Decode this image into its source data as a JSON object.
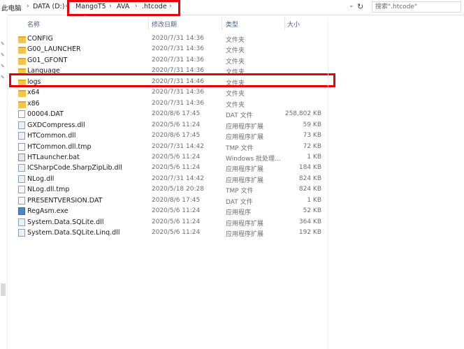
{
  "address": {
    "items": [
      "此电脑",
      "DATA (D:)",
      "MangoT5",
      "AVA",
      ".htcode"
    ],
    "search_placeholder": "搜索\".htcode\""
  },
  "columns": {
    "name": "名称",
    "date": "修改日期",
    "type": "类型",
    "size": "大小"
  },
  "files": [
    {
      "name": "CONFIG",
      "date": "2020/7/31 14:36",
      "type": "文件夹",
      "size": "",
      "icon": "folder-icon"
    },
    {
      "name": "G00_LAUNCHER",
      "date": "2020/7/31 14:36",
      "type": "文件夹",
      "size": "",
      "icon": "folder-icon"
    },
    {
      "name": "G01_GFONT",
      "date": "2020/7/31 14:36",
      "type": "文件夹",
      "size": "",
      "icon": "folder-icon"
    },
    {
      "name": "Language",
      "date": "2020/7/31 14:36",
      "type": "文件夹",
      "size": "",
      "icon": "folder-icon"
    },
    {
      "name": "logs",
      "date": "2020/7/31 14:46",
      "type": "文件夹",
      "size": "",
      "icon": "folder-icon"
    },
    {
      "name": "x64",
      "date": "2020/7/31 14:36",
      "type": "文件夹",
      "size": "",
      "icon": "folder-icon"
    },
    {
      "name": "x86",
      "date": "2020/7/31 14:36",
      "type": "文件夹",
      "size": "",
      "icon": "folder-icon"
    },
    {
      "name": "00004.DAT",
      "date": "2020/8/6 17:45",
      "type": "DAT 文件",
      "size": "258,802 KB",
      "icon": "file-icon"
    },
    {
      "name": "GXDCompress.dll",
      "date": "2020/5/6 11:24",
      "type": "应用程序扩展",
      "size": "59 KB",
      "icon": "dll-icon"
    },
    {
      "name": "HTCommon.dll",
      "date": "2020/8/6 17:45",
      "type": "应用程序扩展",
      "size": "73 KB",
      "icon": "dll-icon"
    },
    {
      "name": "HTCommon.dll.tmp",
      "date": "2020/7/31 14:42",
      "type": "TMP 文件",
      "size": "72 KB",
      "icon": "file-icon"
    },
    {
      "name": "HTLauncher.bat",
      "date": "2020/5/6 11:24",
      "type": "Windows 批处理...",
      "size": "1 KB",
      "icon": "bat-icon"
    },
    {
      "name": "ICSharpCode.SharpZipLib.dll",
      "date": "2020/5/6 11:24",
      "type": "应用程序扩展",
      "size": "184 KB",
      "icon": "dll-icon"
    },
    {
      "name": "NLog.dll",
      "date": "2020/7/31 14:42",
      "type": "应用程序扩展",
      "size": "824 KB",
      "icon": "dll-icon"
    },
    {
      "name": "NLog.dll.tmp",
      "date": "2020/5/18 20:28",
      "type": "TMP 文件",
      "size": "824 KB",
      "icon": "file-icon"
    },
    {
      "name": "PRESENTVERSION.DAT",
      "date": "2020/8/6 17:45",
      "type": "DAT 文件",
      "size": "1 KB",
      "icon": "file-icon"
    },
    {
      "name": "RegAsm.exe",
      "date": "2020/5/6 11:24",
      "type": "应用程序",
      "size": "52 KB",
      "icon": "exe-icon"
    },
    {
      "name": "System.Data.SQLite.dll",
      "date": "2020/5/6 11:24",
      "type": "应用程序扩展",
      "size": "364 KB",
      "icon": "dll-icon"
    },
    {
      "name": "System.Data.SQLite.Linq.dll",
      "date": "2020/5/6 11:24",
      "type": "应用程序扩展",
      "size": "192 KB",
      "icon": "dll-icon"
    }
  ],
  "colors": {
    "highlight": "#e8000b",
    "folder": "#f3c74c",
    "header_text": "#4c607a"
  }
}
